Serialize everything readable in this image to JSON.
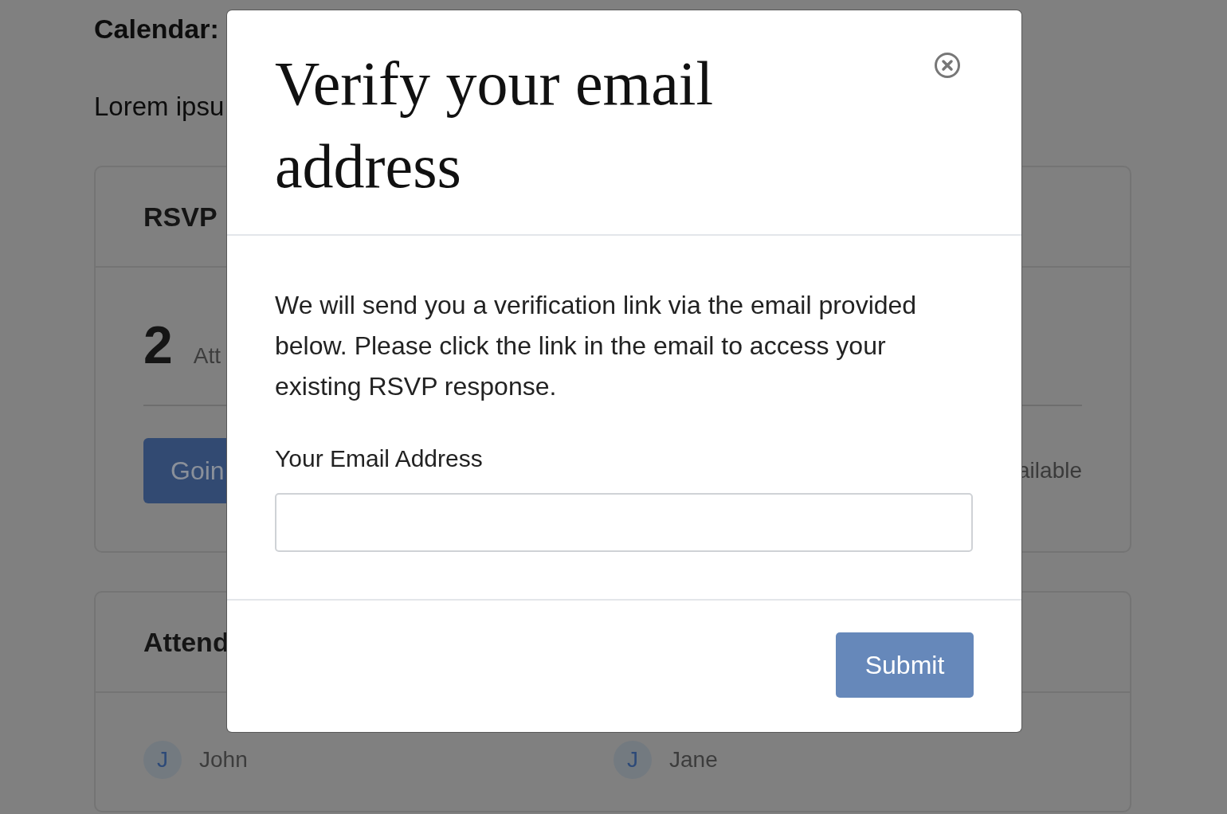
{
  "page": {
    "heading": "Calendar:",
    "intro": "Lorem ipsu",
    "rsvp_card": {
      "title": "RSVP",
      "count": "2",
      "count_label": "Att",
      "going_button": "Goin",
      "status_text": "ailable"
    },
    "attendees_card": {
      "title": "Attend",
      "attendees": [
        {
          "initial": "J",
          "name": "John"
        },
        {
          "initial": "J",
          "name": "Jane"
        }
      ]
    }
  },
  "modal": {
    "title": "Verify your email address",
    "message": "We will send you a verification link via the email provided below. Please click the link in the email to access your existing RSVP response.",
    "email_label": "Your Email Address",
    "submit": "Submit"
  }
}
